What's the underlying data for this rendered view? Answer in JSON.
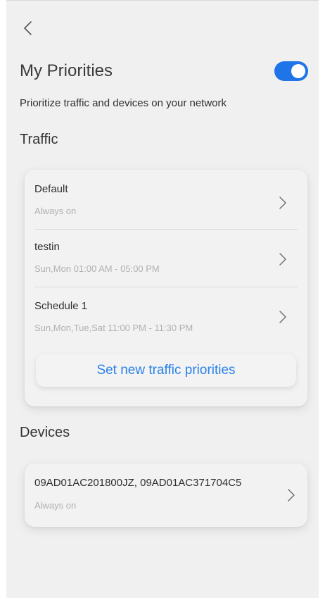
{
  "header": {
    "back_icon": "chevron-left-icon",
    "title": "My Priorities",
    "toggle_state": "on",
    "subtitle": "Prioritize traffic and devices on your network"
  },
  "colors": {
    "accent": "#1f74e8",
    "link": "#2a82ea",
    "background": "#f0f0f0",
    "secondary_text": "#b1b1b1"
  },
  "traffic": {
    "label": "Traffic",
    "items": [
      {
        "title": "Default",
        "subtitle": "Always on"
      },
      {
        "title": "testin",
        "subtitle": "Sun,Mon 01:00 AM - 05:00 PM"
      },
      {
        "title": "Schedule 1",
        "subtitle": "Sun,Mon,Tue,Sat 11:00 PM - 11:30 PM"
      }
    ],
    "set_button": "Set new traffic priorities",
    "chevron_icon": "chevron-right-icon"
  },
  "devices": {
    "label": "Devices",
    "items": [
      {
        "title": "09AD01AC201800JZ, 09AD01AC371704C5",
        "subtitle": "Always on"
      }
    ]
  }
}
